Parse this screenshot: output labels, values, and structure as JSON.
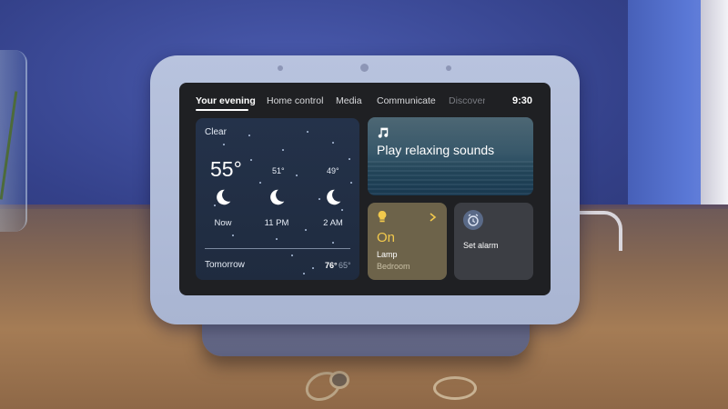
{
  "nav": {
    "tabs": [
      {
        "label": "Your evening",
        "active": true
      },
      {
        "label": "Home control",
        "active": false
      },
      {
        "label": "Media",
        "active": false
      },
      {
        "label": "Communicate",
        "active": false
      },
      {
        "label": "Discover",
        "active": false
      }
    ],
    "time": "9:30"
  },
  "weather": {
    "condition": "Clear",
    "current_temp": "55°",
    "forecast": [
      {
        "temp": "",
        "label": "Now",
        "icon": "moon-icon"
      },
      {
        "temp": "51°",
        "label": "11 PM",
        "icon": "moon-icon"
      },
      {
        "temp": "49°",
        "label": "2 AM",
        "icon": "moon-icon"
      }
    ],
    "tomorrow_label": "Tomorrow",
    "tomorrow_high": "76°",
    "tomorrow_low": "65°"
  },
  "sounds": {
    "icon": "music-note-icon",
    "title": "Play relaxing sounds"
  },
  "lamp": {
    "icon": "lightbulb-icon",
    "state": "On",
    "name": "Lamp",
    "room": "Bedroom"
  },
  "alarm": {
    "icon": "alarm-clock-icon",
    "label": "Set alarm"
  },
  "colors": {
    "screen_bg": "#1f2023",
    "lamp_card": "#6d634a",
    "lamp_on_text": "#f2c94c",
    "device_bezel": "#b8c3de"
  }
}
